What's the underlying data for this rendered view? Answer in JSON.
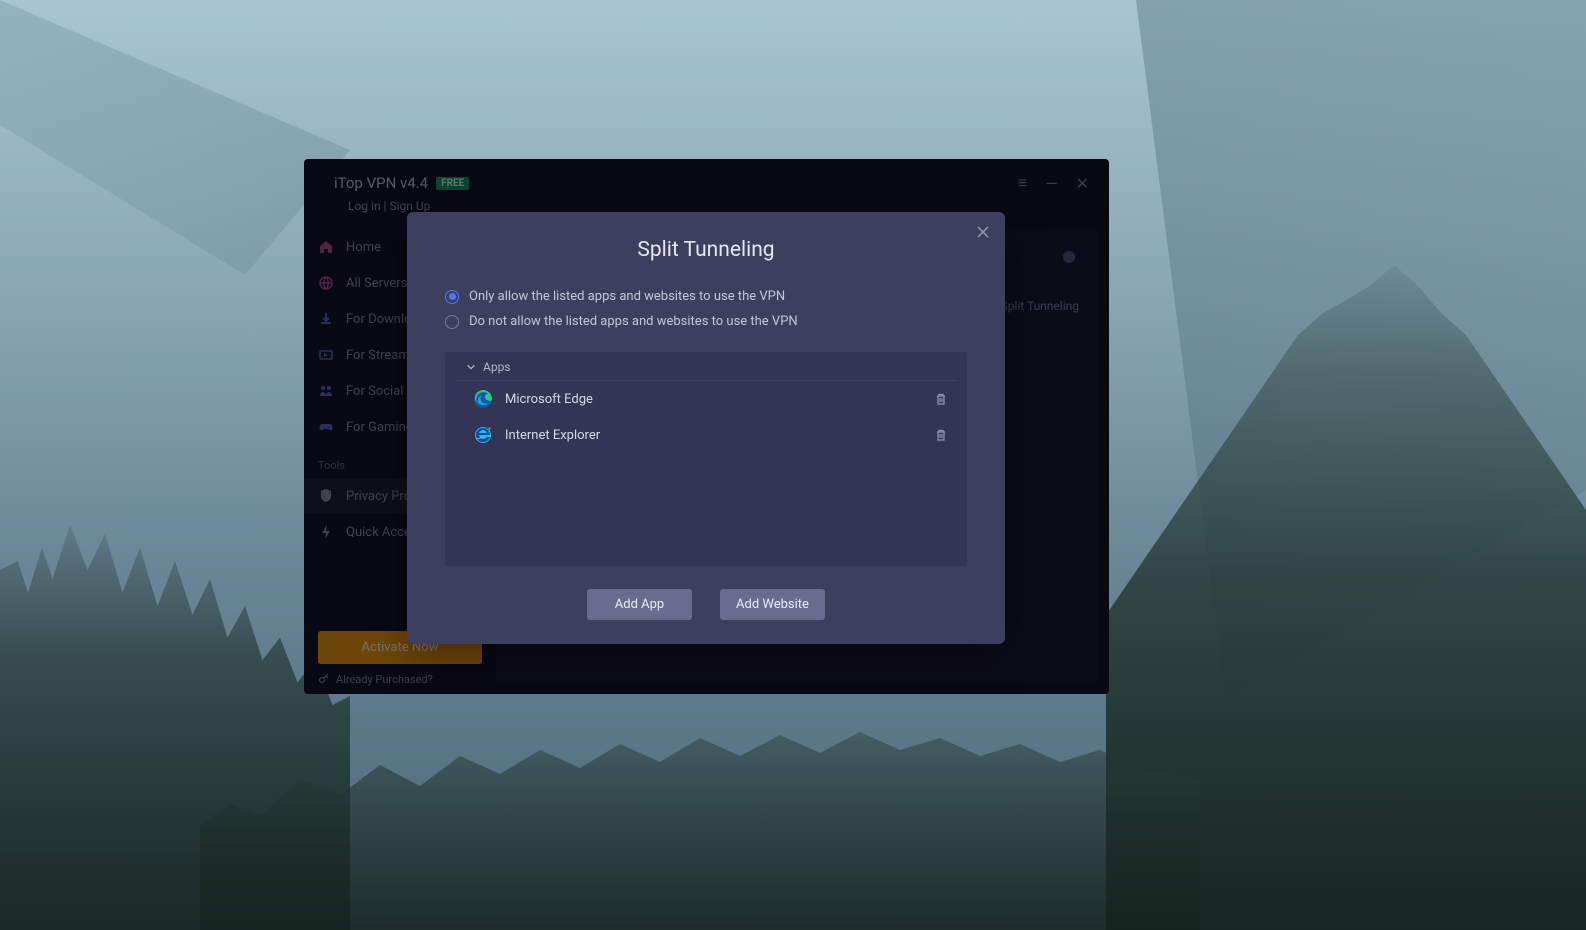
{
  "app": {
    "title": "iTop VPN v4.4",
    "badge": "FREE",
    "auth": "Log in | Sign Up"
  },
  "sidebar": {
    "items": [
      {
        "label": "Home",
        "icon": "home"
      },
      {
        "label": "All Servers",
        "icon": "servers"
      },
      {
        "label": "For Downloading",
        "icon": "download"
      },
      {
        "label": "For Streaming",
        "icon": "streaming"
      },
      {
        "label": "For Social",
        "icon": "social"
      },
      {
        "label": "For Gaming",
        "icon": "gaming"
      }
    ],
    "tools_label": "Tools",
    "tools": [
      {
        "label": "Privacy Protection",
        "icon": "privacy"
      },
      {
        "label": "Quick Access",
        "icon": "quick"
      }
    ],
    "activate": "Activate Now",
    "purchased": "Already Purchased?"
  },
  "main": {
    "right_label": "Split Tunneling"
  },
  "modal": {
    "title": "Split Tunneling",
    "option_allow": "Only allow the listed apps and websites to use the VPN",
    "option_deny": "Do not allow the listed apps and websites to use the VPN",
    "selected_option": "allow",
    "apps_section": "Apps",
    "apps": [
      {
        "name": "Microsoft Edge",
        "icon": "edge"
      },
      {
        "name": "Internet Explorer",
        "icon": "ie"
      }
    ],
    "add_app": "Add App",
    "add_website": "Add Website"
  }
}
